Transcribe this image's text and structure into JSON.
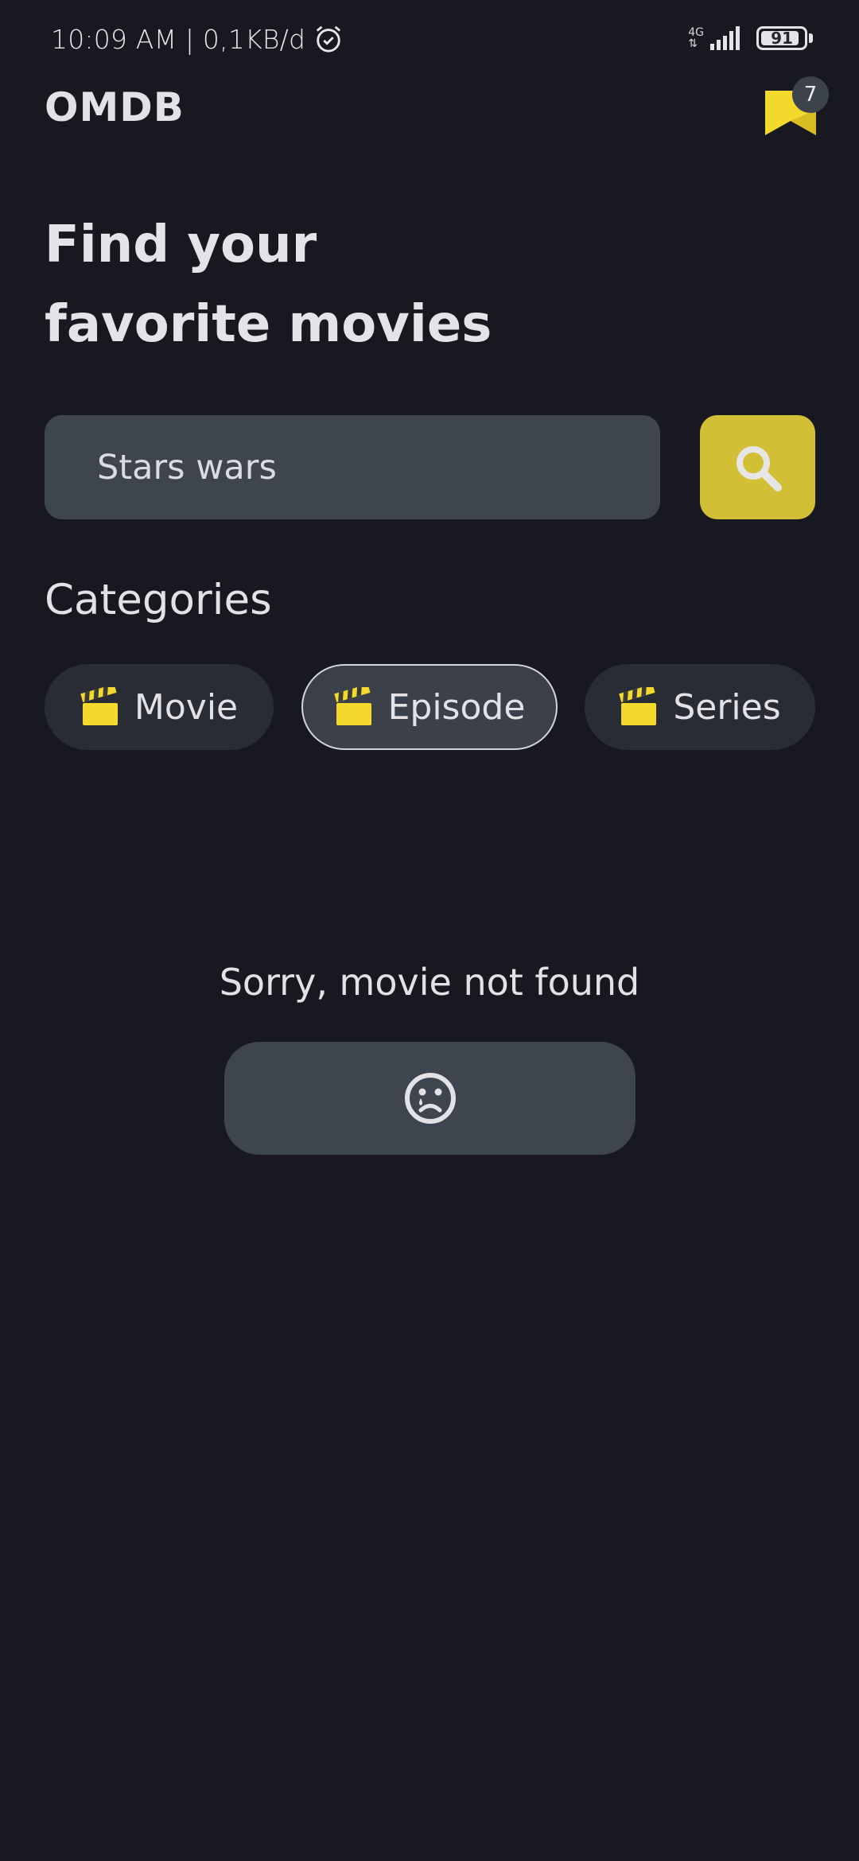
{
  "status_bar": {
    "time_and_speed": "10:09 AM | 0,1KB/d",
    "network": "4G",
    "battery": "91",
    "battery_fraction": 0.91
  },
  "app": {
    "brand": "OMDB",
    "bookmark_count": "7",
    "accent_color": "#f3d92b"
  },
  "headline": {
    "line1": "Find your",
    "line2": "favorite movies"
  },
  "search": {
    "value": "Stars wars",
    "button_icon": "search-icon"
  },
  "categories": {
    "title": "Categories",
    "items": [
      {
        "label": "Movie",
        "icon": "clapperboard-icon",
        "selected": false
      },
      {
        "label": "Episode",
        "icon": "clapperboard-icon",
        "selected": true
      },
      {
        "label": "Series",
        "icon": "clapperboard-icon",
        "selected": false
      }
    ]
  },
  "empty_state": {
    "message": "Sorry, movie not found",
    "icon": "sad-face-icon"
  }
}
